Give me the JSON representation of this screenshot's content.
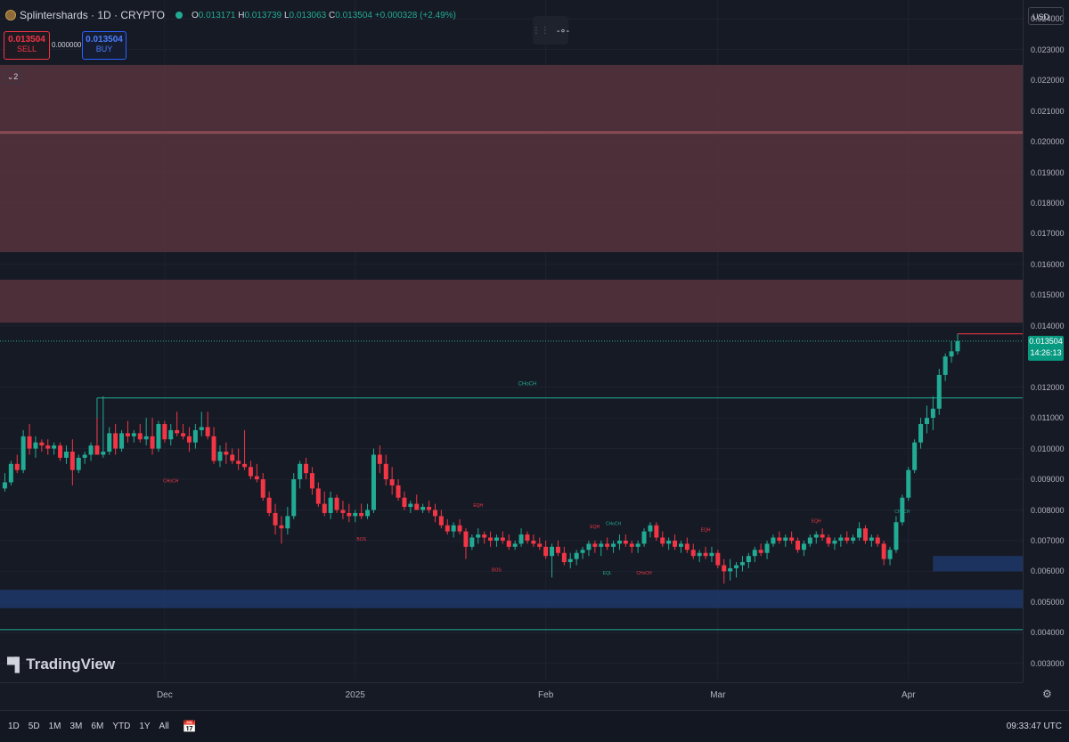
{
  "header": {
    "symbol": "Splintershards · 1D · CRYPTO",
    "o_label": "O",
    "o_value": "0.013171",
    "h_label": "H",
    "h_value": "0.013739",
    "l_label": "L",
    "l_value": "0.013063",
    "c_label": "C",
    "c_value": "0.013504",
    "change": "+0.000328 (+2.49%)"
  },
  "trade": {
    "sell_price": "0.013504",
    "sell_label": "SELL",
    "buy_price": "0.013504",
    "buy_label": "BUY",
    "spread": "0.000000"
  },
  "indicator_count": "2",
  "currency": "USD",
  "last_price": "0.013504",
  "countdown": "14:26:13",
  "brand": "TradingView",
  "ranges": [
    "1D",
    "5D",
    "1M",
    "3M",
    "6M",
    "YTD",
    "1Y",
    "All"
  ],
  "clock": "09:33:47 UTC",
  "colors": {
    "up": "#22ab94",
    "down": "#f23645",
    "supply_zone": "#5b3440",
    "demand_zone": "#1e3a6e",
    "background": "#161a25"
  },
  "icons": {
    "tool": "horizontal-line-icon",
    "calendar": "calendar-icon",
    "settings": "gear-icon"
  },
  "chart_data": {
    "type": "candlestick",
    "ylim": [
      0.0025,
      0.0245
    ],
    "y_ticks": [
      "0.024000",
      "0.023000",
      "0.022000",
      "0.021000",
      "0.020000",
      "0.019000",
      "0.018000",
      "0.017000",
      "0.016000",
      "0.015000",
      "0.014000",
      "0.012000",
      "0.011000",
      "0.010000",
      "0.009000",
      "0.008000",
      "0.007000",
      "0.006000",
      "0.005000",
      "0.004000",
      "0.003000"
    ],
    "y_tick_values": [
      0.024,
      0.023,
      0.022,
      0.021,
      0.02,
      0.019,
      0.018,
      0.017,
      0.016,
      0.015,
      0.014,
      0.012,
      0.011,
      0.01,
      0.009,
      0.008,
      0.007,
      0.006,
      0.005,
      0.004,
      0.003
    ],
    "x_labels": [
      {
        "label": "Dec",
        "index": 26
      },
      {
        "label": "2025",
        "index": 57
      },
      {
        "label": "Feb",
        "index": 88
      },
      {
        "label": "Mar",
        "index": 116
      },
      {
        "label": "Apr",
        "index": 147
      }
    ],
    "candles": [
      [
        0.0087,
        0.0092,
        0.0086,
        0.0089
      ],
      [
        0.0089,
        0.0096,
        0.0088,
        0.0095
      ],
      [
        0.0095,
        0.0098,
        0.0092,
        0.0093
      ],
      [
        0.0093,
        0.0106,
        0.0092,
        0.0104
      ],
      [
        0.0104,
        0.0108,
        0.0098,
        0.01
      ],
      [
        0.01,
        0.0104,
        0.0097,
        0.0102
      ],
      [
        0.0102,
        0.0103,
        0.0099,
        0.0101
      ],
      [
        0.0101,
        0.0103,
        0.0098,
        0.01
      ],
      [
        0.01,
        0.0102,
        0.0098,
        0.0101
      ],
      [
        0.0101,
        0.0102,
        0.0096,
        0.0097
      ],
      [
        0.0097,
        0.0101,
        0.0095,
        0.0099
      ],
      [
        0.0099,
        0.0103,
        0.0088,
        0.0093
      ],
      [
        0.0093,
        0.0098,
        0.0092,
        0.0097
      ],
      [
        0.0097,
        0.0099,
        0.0095,
        0.0098
      ],
      [
        0.0098,
        0.0102,
        0.0096,
        0.0101
      ],
      [
        0.0101,
        0.011,
        0.0099,
        0.0098
      ],
      [
        0.0098,
        0.0117,
        0.0097,
        0.0099
      ],
      [
        0.0099,
        0.0107,
        0.0098,
        0.0105
      ],
      [
        0.0105,
        0.0108,
        0.0098,
        0.01
      ],
      [
        0.01,
        0.0106,
        0.0099,
        0.0105
      ],
      [
        0.0105,
        0.0109,
        0.0102,
        0.0104
      ],
      [
        0.0104,
        0.0106,
        0.0102,
        0.0105
      ],
      [
        0.0105,
        0.0108,
        0.0102,
        0.0103
      ],
      [
        0.0103,
        0.011,
        0.0101,
        0.0104
      ],
      [
        0.0104,
        0.011,
        0.0098,
        0.01
      ],
      [
        0.01,
        0.0109,
        0.0099,
        0.0108
      ],
      [
        0.0108,
        0.0109,
        0.0102,
        0.0103
      ],
      [
        0.0103,
        0.0108,
        0.0101,
        0.0106
      ],
      [
        0.0106,
        0.0112,
        0.0104,
        0.0105
      ],
      [
        0.0105,
        0.0108,
        0.0103,
        0.0104
      ],
      [
        0.0104,
        0.0107,
        0.0099,
        0.0102
      ],
      [
        0.0102,
        0.0108,
        0.01,
        0.0106
      ],
      [
        0.0106,
        0.0112,
        0.0104,
        0.0107
      ],
      [
        0.0107,
        0.0112,
        0.0103,
        0.0104
      ],
      [
        0.0104,
        0.0107,
        0.0095,
        0.0096
      ],
      [
        0.0096,
        0.0101,
        0.0094,
        0.0099
      ],
      [
        0.0099,
        0.0102,
        0.0095,
        0.0098
      ],
      [
        0.0098,
        0.01,
        0.0095,
        0.0096
      ],
      [
        0.0096,
        0.01,
        0.0093,
        0.0095
      ],
      [
        0.0095,
        0.0106,
        0.0093,
        0.0094
      ],
      [
        0.0094,
        0.0096,
        0.009,
        0.0091
      ],
      [
        0.0091,
        0.0095,
        0.0089,
        0.009
      ],
      [
        0.009,
        0.0092,
        0.0083,
        0.0084
      ],
      [
        0.0084,
        0.0086,
        0.0078,
        0.0079
      ],
      [
        0.0079,
        0.0082,
        0.0072,
        0.0075
      ],
      [
        0.0075,
        0.0078,
        0.0069,
        0.0074
      ],
      [
        0.0074,
        0.0081,
        0.0072,
        0.0078
      ],
      [
        0.0078,
        0.0092,
        0.0077,
        0.009
      ],
      [
        0.009,
        0.0096,
        0.0087,
        0.0095
      ],
      [
        0.0095,
        0.0097,
        0.009,
        0.0092
      ],
      [
        0.0092,
        0.0094,
        0.0085,
        0.0087
      ],
      [
        0.0087,
        0.0089,
        0.0081,
        0.0082
      ],
      [
        0.0082,
        0.0086,
        0.0078,
        0.0079
      ],
      [
        0.0079,
        0.0086,
        0.0077,
        0.0084
      ],
      [
        0.0084,
        0.0085,
        0.0079,
        0.008
      ],
      [
        0.008,
        0.0083,
        0.0077,
        0.0079
      ],
      [
        0.0079,
        0.0082,
        0.0076,
        0.0078
      ],
      [
        0.0078,
        0.008,
        0.0076,
        0.0079
      ],
      [
        0.0079,
        0.0082,
        0.0077,
        0.0078
      ],
      [
        0.0078,
        0.0082,
        0.0077,
        0.008
      ],
      [
        0.008,
        0.01,
        0.0079,
        0.0098
      ],
      [
        0.0098,
        0.0101,
        0.0092,
        0.0095
      ],
      [
        0.0095,
        0.0098,
        0.0088,
        0.009
      ],
      [
        0.009,
        0.0094,
        0.0085,
        0.0088
      ],
      [
        0.0088,
        0.009,
        0.0083,
        0.0084
      ],
      [
        0.0084,
        0.0086,
        0.008,
        0.0081
      ],
      [
        0.0081,
        0.0083,
        0.0079,
        0.0082
      ],
      [
        0.0082,
        0.0085,
        0.008,
        0.008
      ],
      [
        0.008,
        0.0082,
        0.0079,
        0.0081
      ],
      [
        0.0081,
        0.0083,
        0.0079,
        0.008
      ],
      [
        0.008,
        0.0082,
        0.0076,
        0.0078
      ],
      [
        0.0078,
        0.008,
        0.0074,
        0.0075
      ],
      [
        0.0075,
        0.0077,
        0.0072,
        0.0073
      ],
      [
        0.0073,
        0.0076,
        0.0071,
        0.0075
      ],
      [
        0.0075,
        0.0077,
        0.0072,
        0.0073
      ],
      [
        0.0073,
        0.0074,
        0.0064,
        0.0068
      ],
      [
        0.0068,
        0.0072,
        0.0067,
        0.0071
      ],
      [
        0.0071,
        0.0074,
        0.0069,
        0.0072
      ],
      [
        0.0072,
        0.0073,
        0.0069,
        0.0071
      ],
      [
        0.0071,
        0.0073,
        0.0068,
        0.007
      ],
      [
        0.007,
        0.0072,
        0.0068,
        0.0071
      ],
      [
        0.0071,
        0.0073,
        0.0069,
        0.007
      ],
      [
        0.007,
        0.0072,
        0.0067,
        0.0068
      ],
      [
        0.0068,
        0.007,
        0.0067,
        0.0069
      ],
      [
        0.0069,
        0.0074,
        0.0068,
        0.0072
      ],
      [
        0.0072,
        0.0073,
        0.0069,
        0.007
      ],
      [
        0.007,
        0.0072,
        0.0068,
        0.0069
      ],
      [
        0.0069,
        0.0071,
        0.0067,
        0.0068
      ],
      [
        0.0068,
        0.007,
        0.0064,
        0.0065
      ],
      [
        0.0065,
        0.0069,
        0.0058,
        0.0068
      ],
      [
        0.0068,
        0.007,
        0.0065,
        0.0066
      ],
      [
        0.0066,
        0.0068,
        0.0062,
        0.0063
      ],
      [
        0.0063,
        0.0066,
        0.0061,
        0.0064
      ],
      [
        0.0064,
        0.0067,
        0.0062,
        0.0066
      ],
      [
        0.0066,
        0.0068,
        0.0064,
        0.0067
      ],
      [
        0.0067,
        0.007,
        0.0065,
        0.0069
      ],
      [
        0.0069,
        0.007,
        0.0066,
        0.0068
      ],
      [
        0.0068,
        0.007,
        0.0065,
        0.0069
      ],
      [
        0.0069,
        0.0071,
        0.0067,
        0.0068
      ],
      [
        0.0068,
        0.007,
        0.0066,
        0.0069
      ],
      [
        0.0069,
        0.0072,
        0.0067,
        0.007
      ],
      [
        0.007,
        0.0072,
        0.0068,
        0.0069
      ],
      [
        0.0069,
        0.007,
        0.0066,
        0.0068
      ],
      [
        0.0068,
        0.007,
        0.0066,
        0.0069
      ],
      [
        0.0069,
        0.0074,
        0.0068,
        0.0073
      ],
      [
        0.0073,
        0.0076,
        0.0071,
        0.0075
      ],
      [
        0.0075,
        0.0076,
        0.007,
        0.0071
      ],
      [
        0.0071,
        0.0073,
        0.0068,
        0.0069
      ],
      [
        0.0069,
        0.0071,
        0.0067,
        0.007
      ],
      [
        0.007,
        0.0072,
        0.0067,
        0.0068
      ],
      [
        0.0068,
        0.007,
        0.0066,
        0.0069
      ],
      [
        0.0069,
        0.0071,
        0.0066,
        0.0067
      ],
      [
        0.0067,
        0.0069,
        0.0064,
        0.0065
      ],
      [
        0.0065,
        0.0067,
        0.0063,
        0.0066
      ],
      [
        0.0066,
        0.0068,
        0.0064,
        0.0065
      ],
      [
        0.0065,
        0.0068,
        0.0063,
        0.0066
      ],
      [
        0.0066,
        0.0067,
        0.0061,
        0.0062
      ],
      [
        0.0062,
        0.0064,
        0.0056,
        0.006
      ],
      [
        0.006,
        0.0064,
        0.0057,
        0.0061
      ],
      [
        0.0061,
        0.0063,
        0.0058,
        0.0062
      ],
      [
        0.0062,
        0.0065,
        0.006,
        0.0063
      ],
      [
        0.0063,
        0.0066,
        0.0061,
        0.0065
      ],
      [
        0.0065,
        0.0068,
        0.0063,
        0.0067
      ],
      [
        0.0067,
        0.0069,
        0.0065,
        0.0066
      ],
      [
        0.0066,
        0.007,
        0.0064,
        0.0069
      ],
      [
        0.0069,
        0.0072,
        0.0068,
        0.0071
      ],
      [
        0.0071,
        0.0073,
        0.0069,
        0.007
      ],
      [
        0.007,
        0.0072,
        0.0068,
        0.0071
      ],
      [
        0.0071,
        0.0073,
        0.0069,
        0.007
      ],
      [
        0.007,
        0.0071,
        0.0066,
        0.0067
      ],
      [
        0.0067,
        0.007,
        0.0065,
        0.0069
      ],
      [
        0.0069,
        0.0072,
        0.0068,
        0.0071
      ],
      [
        0.0071,
        0.0073,
        0.0069,
        0.0072
      ],
      [
        0.0072,
        0.0074,
        0.007,
        0.0071
      ],
      [
        0.0071,
        0.0072,
        0.0068,
        0.0069
      ],
      [
        0.0069,
        0.0071,
        0.0067,
        0.007
      ],
      [
        0.007,
        0.0072,
        0.0068,
        0.0071
      ],
      [
        0.0071,
        0.0073,
        0.0069,
        0.007
      ],
      [
        0.007,
        0.0072,
        0.0069,
        0.0071
      ],
      [
        0.0071,
        0.0076,
        0.007,
        0.0074
      ],
      [
        0.0074,
        0.0075,
        0.0069,
        0.007
      ],
      [
        0.007,
        0.0072,
        0.0068,
        0.0071
      ],
      [
        0.0071,
        0.0072,
        0.0068,
        0.0069
      ],
      [
        0.0069,
        0.007,
        0.0062,
        0.0064
      ],
      [
        0.0064,
        0.0068,
        0.0062,
        0.0067
      ],
      [
        0.0067,
        0.0078,
        0.0066,
        0.0076
      ],
      [
        0.0076,
        0.0085,
        0.0075,
        0.0084
      ],
      [
        0.0084,
        0.0094,
        0.0083,
        0.0093
      ],
      [
        0.0093,
        0.0103,
        0.0092,
        0.0102
      ],
      [
        0.0102,
        0.011,
        0.01,
        0.0108
      ],
      [
        0.0108,
        0.0114,
        0.0105,
        0.011
      ],
      [
        0.011,
        0.0117,
        0.0106,
        0.0113
      ],
      [
        0.0113,
        0.0126,
        0.0111,
        0.0124
      ],
      [
        0.0124,
        0.0131,
        0.0122,
        0.013
      ],
      [
        0.013,
        0.0135,
        0.0128,
        0.01317
      ],
      [
        0.013171,
        0.013739,
        0.013063,
        0.013504
      ]
    ],
    "zones": [
      {
        "y1": 0.0225,
        "y2": 0.0164,
        "color": "#5b3440"
      },
      {
        "y1": 0.0155,
        "y2": 0.0141,
        "color": "#5b3440"
      },
      {
        "y1": 0.0054,
        "y2": 0.0048,
        "color": "#1e3a6e"
      },
      {
        "x1i": 151,
        "y1": 0.0065,
        "y2": 0.006,
        "color": "#1e3a6e"
      }
    ],
    "lines": [
      {
        "y": 0.0203,
        "color": "#8a4a55",
        "width": 3
      },
      {
        "y": 0.0041,
        "color": "#22ab94",
        "width": 1
      },
      {
        "y": 0.01165,
        "x1i": 15,
        "color": "#22ab94",
        "width": 1,
        "label": "CHoCH",
        "label_i": 85
      }
    ],
    "annotations": [
      {
        "text": "CHoCH",
        "i": 27,
        "y": 0.0089,
        "color": "#f23645"
      },
      {
        "text": "BOS",
        "i": 58,
        "y": 0.007,
        "color": "#f23645"
      },
      {
        "text": "EQH",
        "i": 77,
        "y": 0.0081,
        "color": "#f23645"
      },
      {
        "text": "BOS",
        "i": 80,
        "y": 0.006,
        "color": "#f23645"
      },
      {
        "text": "EQH",
        "i": 96,
        "y": 0.0074,
        "color": "#f23645"
      },
      {
        "text": "CHoCH",
        "i": 99,
        "y": 0.0075,
        "color": "#22ab94"
      },
      {
        "text": "EQL",
        "i": 98,
        "y": 0.0059,
        "color": "#22ab94"
      },
      {
        "text": "CHoCH",
        "i": 104,
        "y": 0.0059,
        "color": "#f23645"
      },
      {
        "text": "EQH",
        "i": 114,
        "y": 0.0073,
        "color": "#f23645"
      },
      {
        "text": "EQH",
        "i": 132,
        "y": 0.0076,
        "color": "#f23645"
      },
      {
        "text": "CHoCH",
        "i": 146,
        "y": 0.0079,
        "color": "#22ab94"
      }
    ]
  }
}
